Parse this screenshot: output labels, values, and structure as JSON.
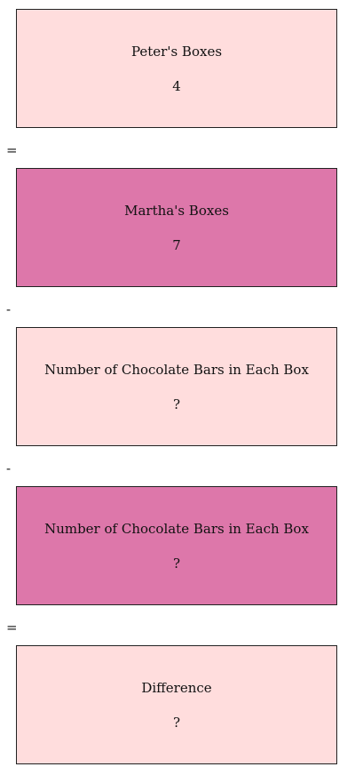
{
  "colors": {
    "light": "#ffdddd",
    "dark": "#dd77aa",
    "border": "#222222"
  },
  "boxes": [
    {
      "label": "Peter's Boxes",
      "value": "4",
      "fill": "#ffdddd"
    },
    {
      "label": "Martha's Boxes",
      "value": "7",
      "fill": "#dd77aa"
    },
    {
      "label": "Number of Chocolate Bars in Each Box",
      "value": "?",
      "fill": "#ffdddd"
    },
    {
      "label": "Number of Chocolate Bars in Each Box",
      "value": "?",
      "fill": "#dd77aa"
    },
    {
      "label": "Difference",
      "value": "?",
      "fill": "#ffdddd"
    }
  ],
  "operators": [
    "=",
    "-",
    "-",
    "="
  ]
}
